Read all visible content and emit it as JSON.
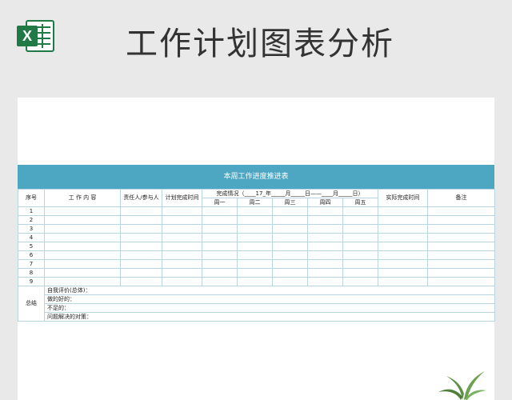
{
  "page": {
    "title": "工作计划图表分析",
    "icon": "excel-icon",
    "icon_letter": "X",
    "accent": "#4ea7c2"
  },
  "sheet": {
    "banner_title": "本周工作进度推进表",
    "headers": {
      "seq": "序号",
      "content": "工  作  内  容",
      "owner": "责任人/参与人",
      "planned_time": "计划完成时间",
      "status": "完成情况（____17_年_____月_____日——____月_____日）",
      "actual_time": "实际完成时间",
      "notes": "备注"
    },
    "weekdays": [
      "周一",
      "周二",
      "周三",
      "周四",
      "周五"
    ],
    "rows": [
      "1",
      "2",
      "3",
      "4",
      "5",
      "6",
      "7",
      "8",
      "9"
    ],
    "summary": {
      "label": "总结",
      "lines": [
        "自我评价(总体)：",
        "做的好的：",
        "不足的：",
        "问题解决的对策："
      ]
    }
  }
}
